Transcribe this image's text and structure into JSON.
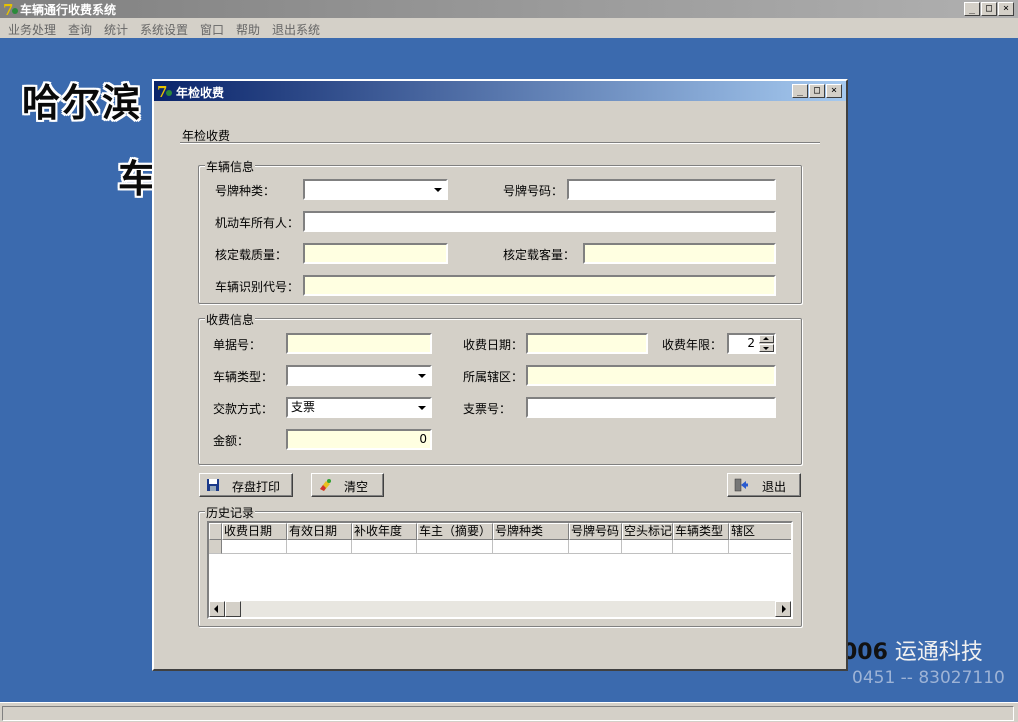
{
  "app": {
    "title": "车辆通行收费系统",
    "menu": [
      "业务处理",
      "查询",
      "统计",
      "系统设置",
      "窗口",
      "帮助",
      "退出系统"
    ]
  },
  "desktop": {
    "banner_line1": "哈尔滨",
    "banner_line2": "车",
    "company_year": "006",
    "company_name": " 运通科技",
    "phone": "0451 -- 83027110"
  },
  "dialog": {
    "title": "年检收费",
    "heading": "年检收费",
    "vehicle_group": {
      "label": "车辆信息",
      "plate_type_label": "号牌种类：",
      "plate_type_value": "",
      "plate_number_label": "号牌号码：",
      "plate_number_value": "",
      "owner_label": "机动车所有人：",
      "owner_value": "",
      "rated_mass_label": "核定载质量：",
      "rated_mass_value": "",
      "rated_passenger_label": "核定载客量：",
      "rated_passenger_value": "",
      "vin_label": "车辆识别代号：",
      "vin_value": ""
    },
    "fee_group": {
      "label": "收费信息",
      "receipt_label": "单据号：",
      "receipt_value": "",
      "fee_date_label": "收费日期：",
      "fee_date_value": "",
      "fee_years_label": "收费年限：",
      "fee_years_value": "2",
      "vehicle_type_label": "车辆类型：",
      "vehicle_type_value": "",
      "district_label": "所属辖区：",
      "district_value": "",
      "payment_label": "交款方式：",
      "payment_value": "支票",
      "check_no_label": "支票号：",
      "check_no_value": "",
      "amount_label": "金额：",
      "amount_value": "0"
    },
    "buttons": {
      "save_print": "存盘打印",
      "clear": "清空",
      "exit": "退出"
    },
    "history": {
      "label": "历史记录",
      "columns": [
        "收费日期",
        "有效日期",
        "补收年度",
        "车主（摘要）",
        "号牌种类",
        "号牌号码",
        "空头标记",
        "车辆类型",
        "辖区"
      ]
    }
  },
  "colors": {
    "desktop_bg": "#3b6aae",
    "dialog_title_start": "#0a246a",
    "dialog_title_end": "#a6caf0",
    "readonly_field": "#ffffe1"
  }
}
